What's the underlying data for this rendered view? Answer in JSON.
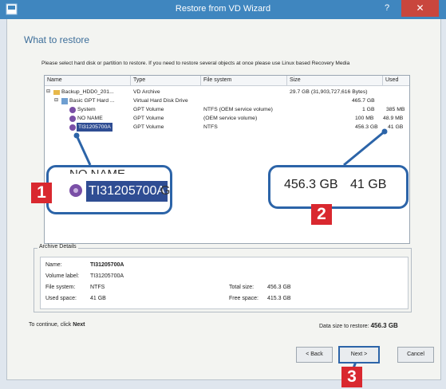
{
  "window": {
    "title": "Restore from VD Wizard",
    "help_label": "?",
    "close_label": "✕"
  },
  "page": {
    "title": "What to restore",
    "instructions": "Please select hard disk or partition to restore. If you need to restore several objects at once please use Linux based Recovery Media"
  },
  "tree": {
    "columns": [
      "Name",
      "Type",
      "File system",
      "Size",
      "Used"
    ],
    "rows": [
      {
        "name": "Backup_HDD0_201...",
        "type": "VD Archive",
        "fs": "",
        "size": "29.7 GB (31,903,727,616 Bytes)",
        "used": ""
      },
      {
        "name": "Basic GPT Hard ...",
        "type": "Virtual Hard Disk Drive",
        "fs": "",
        "size": "465.7 GB",
        "used": ""
      },
      {
        "name": "System",
        "type": "GPT Volume",
        "fs": "NTFS (OEM service volume)",
        "size": "1 GB",
        "used": "385 MB"
      },
      {
        "name": "NO NAME",
        "type": "GPT Volume",
        "fs": "(OEM service volume)",
        "size": "100 MB",
        "used": "48.9 MB"
      },
      {
        "name": "TI31205700A",
        "type": "GPT Volume",
        "fs": "NTFS",
        "size": "456.3 GB",
        "used": "41 GB"
      }
    ]
  },
  "callout1": {
    "partial_above": "NO NAME",
    "selected_name": "TI31205700A",
    "partial_right": "G",
    "badge": "1"
  },
  "callout2": {
    "size": "456.3 GB",
    "used": "41 GB",
    "badge": "2"
  },
  "details": {
    "legend": "Archive Details",
    "name_label": "Name:",
    "name_value": "TI31205700A",
    "volume_label_label": "Volume label:",
    "volume_label_value": "TI31205700A",
    "fs_label": "File system:",
    "fs_value": "NTFS",
    "used_label": "Used space:",
    "used_value": "41 GB",
    "total_label": "Total size:",
    "total_value": "456.3 GB",
    "free_label": "Free space:",
    "free_value": "415.3 GB"
  },
  "footer": {
    "continue_prefix": "To continue, click",
    "continue_word": "Next",
    "data_size_label": "Data size to restore:",
    "data_size_value": "456.3 GB"
  },
  "buttons": {
    "back": "< Back",
    "next": "Next >",
    "cancel": "Cancel",
    "badge3": "3"
  },
  "colors": {
    "titlebar": "#3f86bf",
    "selection": "#2f4d93",
    "callout_border": "#2c64a8",
    "badge": "#d9282f",
    "title_text": "#3d6e9a"
  }
}
